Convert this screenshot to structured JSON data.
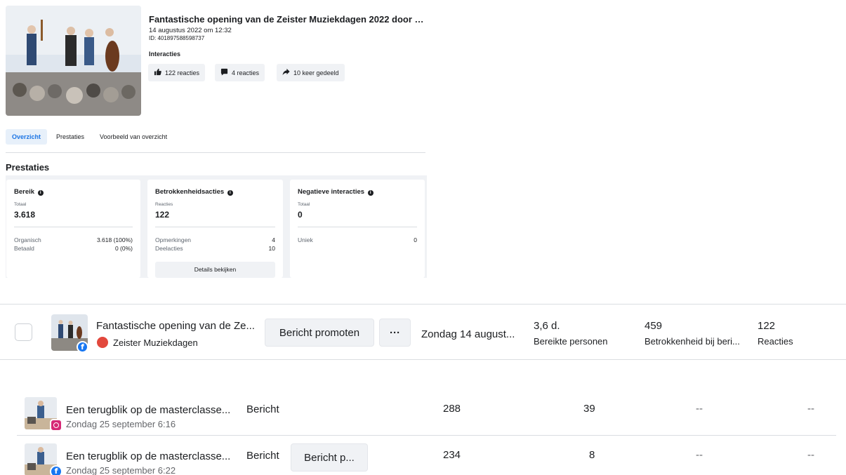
{
  "post": {
    "title": "Fantastische opening van de Zeister Muziekdagen 2022 door Cu...",
    "date": "14 augustus 2022 om 12:32",
    "id": "ID: 401897588598737",
    "interactions_label": "Interacties",
    "chips": [
      {
        "icon": "thumbs-up-icon",
        "label": "122 reacties"
      },
      {
        "icon": "comment-icon",
        "label": "4 reacties"
      },
      {
        "icon": "share-icon",
        "label": "10 keer gedeeld"
      }
    ]
  },
  "tabs": [
    "Overzicht",
    "Prestaties",
    "Voorbeeld van overzicht"
  ],
  "performance": {
    "title": "Prestaties",
    "reach": {
      "title": "Bereik",
      "sub": "Totaal",
      "value": "3.618",
      "rows": [
        {
          "label": "Organisch",
          "value": "3.618 (100%)"
        },
        {
          "label": "Betaald",
          "value": "0 (0%)"
        }
      ]
    },
    "engagement": {
      "title": "Betrokkenheidsacties",
      "sub": "Reacties",
      "value": "122",
      "rows": [
        {
          "label": "Opmerkingen",
          "value": "4"
        },
        {
          "label": "Deelacties",
          "value": "10"
        }
      ],
      "button": "Details bekijken"
    },
    "negative": {
      "title": "Negatieve interacties",
      "sub": "Totaal",
      "value": "0",
      "rows": [
        {
          "label": "Uniek",
          "value": "0"
        }
      ]
    }
  },
  "mid_row": {
    "title": "Fantastische opening van de Ze...",
    "page_name": "Zeister Muziekdagen",
    "promote_label": "Bericht promoten",
    "more_label": "···",
    "date": "Zondag 14 august...",
    "metrics": [
      {
        "value": "3,6 d.",
        "label": "Bereikte personen"
      },
      {
        "value": "459",
        "label": "Betrokkenheid bij beri..."
      },
      {
        "value": "122",
        "label": "Reacties"
      }
    ]
  },
  "rows": [
    {
      "title": "Een terugblik op de masterclasse...",
      "date": "Zondag 25 september 6:16",
      "platform": "instagram",
      "type": "Bericht",
      "promote": "",
      "reach": "288",
      "engagement": "39",
      "col3": "--",
      "col4": "--"
    },
    {
      "title": "Een terugblik op de masterclasse...",
      "date": "Zondag 25 september 6:22",
      "platform": "facebook",
      "type": "Bericht",
      "promote": "Bericht p...",
      "reach": "234",
      "engagement": "8",
      "col3": "--",
      "col4": "--"
    }
  ],
  "colors": {
    "accent": "#1b74e4",
    "facebook": "#1877f2",
    "instagram": "#d62976",
    "panel": "#f0f2f5",
    "border": "#dadde1"
  }
}
